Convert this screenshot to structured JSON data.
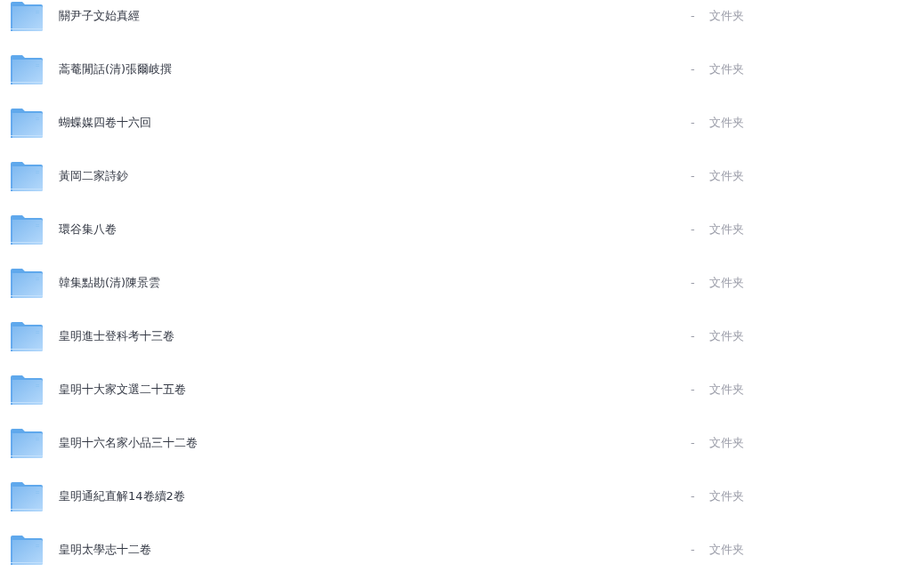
{
  "files": [
    {
      "name": "關尹子文始真經",
      "size": "-",
      "type": "文件夹"
    },
    {
      "name": "蒿菴閒話(清)張爾岐撰",
      "size": "-",
      "type": "文件夹"
    },
    {
      "name": "蝴蝶媒四卷十六回",
      "size": "-",
      "type": "文件夹"
    },
    {
      "name": "黃岡二家詩鈔",
      "size": "-",
      "type": "文件夹"
    },
    {
      "name": "環谷集八卷",
      "size": "-",
      "type": "文件夹"
    },
    {
      "name": "韓集點勘(清)陳景雲",
      "size": "-",
      "type": "文件夹"
    },
    {
      "name": "皇明進士登科考十三卷",
      "size": "-",
      "type": "文件夹"
    },
    {
      "name": "皇明十大家文選二十五卷",
      "size": "-",
      "type": "文件夹"
    },
    {
      "name": "皇明十六名家小品三十二卷",
      "size": "-",
      "type": "文件夹"
    },
    {
      "name": "皇明通紀直解14卷續2卷",
      "size": "-",
      "type": "文件夹"
    },
    {
      "name": "皇明太學志十二卷",
      "size": "-",
      "type": "文件夹"
    }
  ]
}
